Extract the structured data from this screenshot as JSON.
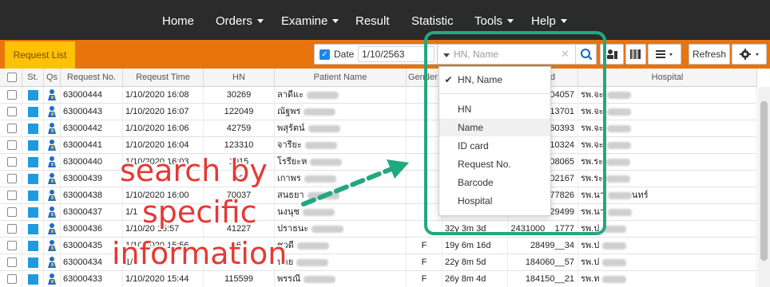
{
  "nav": {
    "items": [
      {
        "label": "Home",
        "dropdown": false
      },
      {
        "label": "Orders",
        "dropdown": true
      },
      {
        "label": "Examine",
        "dropdown": true
      },
      {
        "label": "Result",
        "dropdown": false
      },
      {
        "label": "Statistic",
        "dropdown": false
      },
      {
        "label": "Tools",
        "dropdown": true
      },
      {
        "label": "Help",
        "dropdown": true
      }
    ]
  },
  "toolbar": {
    "tab_label": "Request List",
    "date_label": "Date",
    "date_checked": true,
    "date_value": "1/10/2563",
    "search_placeholder": "HN, Name",
    "refresh_label": "Refresh"
  },
  "colors": {
    "navbar": "#2b2b2b",
    "toolbar": "#e8740e",
    "tab": "#ffc107",
    "status": "#1e9be0",
    "highlight": "#22a881",
    "annotation": "#e53935"
  },
  "table": {
    "columns": [
      "St.",
      "Qs",
      "Request No.",
      "Reqeust Time",
      "HN",
      "Patient Name",
      "Gender",
      "d",
      "Hospital"
    ],
    "rows": [
      {
        "request_no": "63000444",
        "time": "1/10/2020  16:08",
        "hn": "30269",
        "name": "ลาดีแะ",
        "gender": "",
        "age": "",
        "id_tail": "04057",
        "hospital": "รพ.จะ"
      },
      {
        "request_no": "63000443",
        "time": "1/10/2020  16:07",
        "hn": "122049",
        "name": "ณัฐพร",
        "gender": "",
        "age": "",
        "id_tail": "13701",
        "hospital": "รพ.จะ"
      },
      {
        "request_no": "63000442",
        "time": "1/10/2020  16:06",
        "hn": "42759",
        "name": "พสุรัตน์",
        "gender": "",
        "age": "",
        "id_tail": "60393",
        "hospital": "รพ.จะ"
      },
      {
        "request_no": "63000441",
        "time": "1/10/2020  16:04",
        "hn": "123310",
        "name": "จารียะ",
        "gender": "",
        "age": "",
        "id_tail": "10324",
        "hospital": "รพ.จะ"
      },
      {
        "request_no": "63000440",
        "time": "1/10/2020  16:03",
        "hn": "1015",
        "name": "โรรียะห",
        "gender": "",
        "age": "",
        "id_tail": "08065",
        "hospital": "รพ.ระ"
      },
      {
        "request_no": "63000439",
        "time": "",
        "hn": "66",
        "name": "เกาพร",
        "gender": "",
        "age": "",
        "id_tail": "02167",
        "hospital": "รพ.ระ"
      },
      {
        "request_no": "63000438",
        "time": "1/10/2020  16:00",
        "hn": "70037",
        "name": "สนธยา",
        "gender": "",
        "age": "",
        "id_tail": "77826",
        "hospital": "รพ.นา",
        "hospital_extra": "นทร์"
      },
      {
        "request_no": "63000437",
        "time": "1/1",
        "hn": "",
        "name": "นงนุช",
        "gender": "",
        "age": "",
        "id_tail": "29499",
        "hospital": "รพ.นา"
      },
      {
        "request_no": "63000436",
        "time": "1/10/20  15:57",
        "hn": "41227",
        "name": "ปราธนะ",
        "gender": "",
        "age": "32y 3m 3d",
        "id_tail": "2431000__1777",
        "hospital": "รพ.ป"
      },
      {
        "request_no": "63000435",
        "time": "1/10/2020  15:56",
        "hn": "161",
        "name": "ชวดี",
        "gender": "F",
        "age": "19y 6m 16d",
        "id_tail": "28499__34",
        "hospital": "รพ.ป"
      },
      {
        "request_no": "63000434",
        "time": "1/",
        "hn": "",
        "name": "นาย",
        "gender": "F",
        "age": "22y 8m 5d",
        "id_tail": "184060__57",
        "hospital": "รพ.ป"
      },
      {
        "request_no": "63000433",
        "time": "1/10/2020  15:44",
        "hn": "115599",
        "name": "พรรณี",
        "gender": "F",
        "age": "26y 8m 4d",
        "id_tail": "184150__21",
        "hospital": "รพ.ท"
      }
    ]
  },
  "search_dropdown": {
    "items": [
      {
        "label": "HN, Name",
        "selected": true
      },
      {
        "label": "HN",
        "selected": false
      },
      {
        "label": "Name",
        "selected": false
      },
      {
        "label": "ID card",
        "selected": false
      },
      {
        "label": "Request No.",
        "selected": false
      },
      {
        "label": "Barcode",
        "selected": false
      },
      {
        "label": "Hospital",
        "selected": false
      }
    ]
  },
  "annotation": {
    "lines": [
      "search by",
      "specific",
      "information"
    ]
  }
}
